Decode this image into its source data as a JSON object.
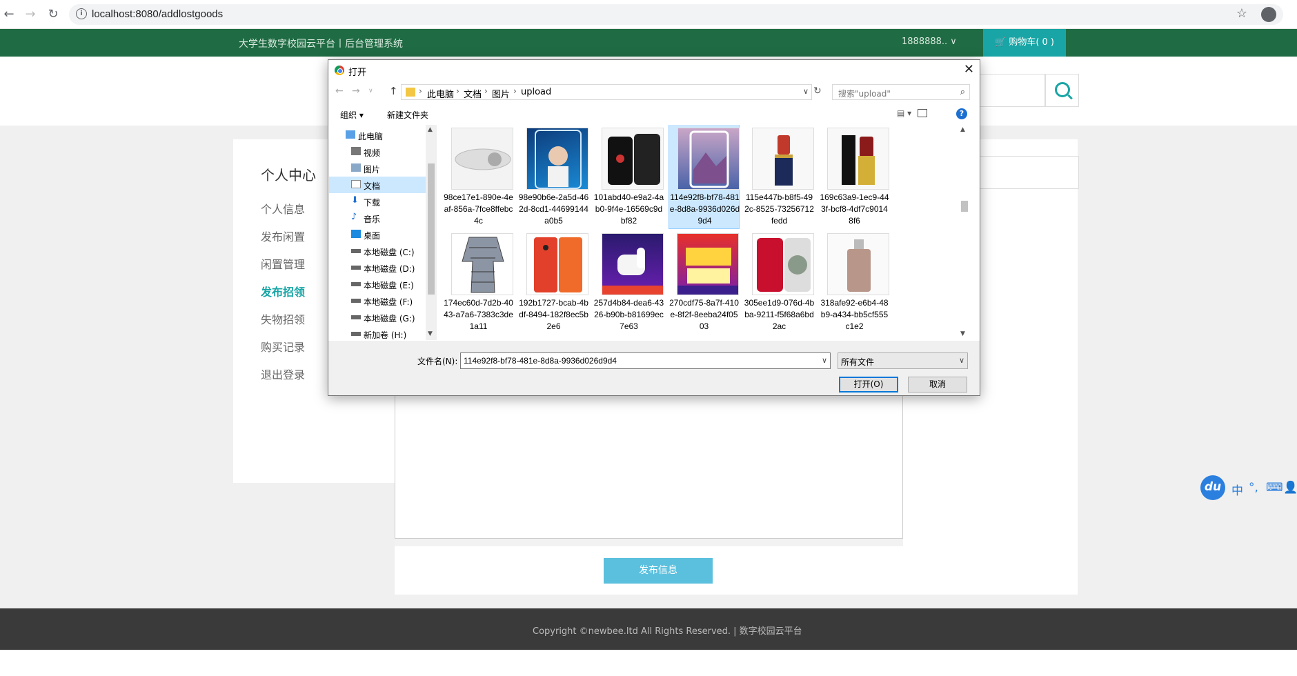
{
  "browser": {
    "url": "localhost:8080/addlostgoods"
  },
  "site": {
    "brand": "大学生数字校园云平台丨后台管理系统",
    "user": "1888888.. ∨",
    "cart": "购物车( 0 )"
  },
  "sidebar": {
    "title": "个人中心",
    "items": [
      {
        "label": "个人信息"
      },
      {
        "label": "发布闲置"
      },
      {
        "label": "闲置管理"
      },
      {
        "label": "发布招领"
      },
      {
        "label": "失物招领"
      },
      {
        "label": "购买记录"
      },
      {
        "label": "退出登录"
      }
    ],
    "active": "发布招领"
  },
  "publish_button": "发布信息",
  "footer": {
    "text": "Copyright ©newbee.ltd All Rights Reserved.  |  数字校园云平台"
  },
  "ime": {
    "logo": "du",
    "mode": "中",
    "punct": "°,"
  },
  "dialog": {
    "title": "打开",
    "breadcrumb": [
      "此电脑",
      "文档",
      "图片",
      "upload"
    ],
    "search_placeholder": "搜索\"upload\"",
    "toolbar": {
      "organize": "组织 ▾",
      "new_folder": "新建文件夹"
    },
    "nav_items": [
      {
        "label": "此电脑"
      },
      {
        "label": "视频"
      },
      {
        "label": "图片"
      },
      {
        "label": "文档"
      },
      {
        "label": "下载"
      },
      {
        "label": "音乐"
      },
      {
        "label": "桌面"
      },
      {
        "label": "本地磁盘 (C:)"
      },
      {
        "label": "本地磁盘 (D:)"
      },
      {
        "label": "本地磁盘 (E:)"
      },
      {
        "label": "本地磁盘 (F:)"
      },
      {
        "label": "本地磁盘 (G:)"
      },
      {
        "label": "新加卷 (H:)"
      }
    ],
    "files": [
      {
        "name": "98ce17e1-890e-4eaf-856a-7fce8ffebc4c"
      },
      {
        "name": "98e90b6e-2a5d-462d-8cd1-44699144a0b5"
      },
      {
        "name": "101abd40-e9a2-4ab0-9f4e-16569c9dbf82"
      },
      {
        "name": "114e92f8-bf78-481e-8d8a-9936d026d9d4"
      },
      {
        "name": "115e447b-b8f5-492c-8525-73256712fedd"
      },
      {
        "name": "169c63a9-1ec9-443f-bcf8-4df7c90148f6"
      },
      {
        "name": "174ec60d-7d2b-4043-a7a6-7383c3de1a11"
      },
      {
        "name": "192b1727-bcab-4bdf-8494-182f8ec5b2e6"
      },
      {
        "name": "257d4b84-dea6-4326-b90b-b81699ec7e63"
      },
      {
        "name": "270cdf75-8a7f-410e-8f2f-8eeba24f0503"
      },
      {
        "name": "305ee1d9-076d-4bba-9211-f5f68a6bd2ac"
      },
      {
        "name": "318afe92-e6b4-48b9-a434-bb5cf555c1e2"
      }
    ],
    "filename_label": "文件名(N):",
    "filename_value": "114e92f8-bf78-481e-8d8a-9936d026d9d4",
    "filetype_value": "所有文件",
    "open_button": "打开(O)",
    "cancel_button": "取消"
  }
}
